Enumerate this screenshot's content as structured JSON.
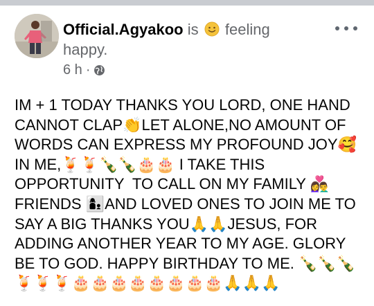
{
  "post": {
    "author": "Official.Agyakoo",
    "is_word": "is",
    "feeling_icon": "slightly-smiling-face-icon",
    "feeling_text": "feeling happy.",
    "timestamp": "6 h",
    "separator": "·",
    "audience_icon": "globe-icon",
    "more_icon": "more-options-icon",
    "body": "IM + 1 TODAY THANKS YOU LORD, ONE HAND CANNOT CLAP👏LET ALONE,NO AMOUNT OF WORDS CAN EXPRESS MY PROFOUND JOY🥰 IN ME,🍹🍹🍾🍾🎂🎂 I TAKE THIS OPPORTUNITY  TO CALL ON MY FAMILY 👩‍❤️‍👨 FRIENDS 👩‍👦AND LOVED ONES TO JOIN ME TO SAY A BIG THANKS YOU🙏🙏JESUS, FOR ADDING ANOTHER YEAR TO MY AGE. GLORY BE TO GOD. HAPPY BIRTHDAY TO ME. 🍾🍾🍾🍹🍹🍹🎂🎂🎂🎂🎂🎂🎂🎂🙏🙏🙏"
  },
  "colors": {
    "text_primary": "#050505",
    "text_secondary": "#65676b",
    "background": "#ffffff",
    "top_strip": "#c9ccd1"
  }
}
